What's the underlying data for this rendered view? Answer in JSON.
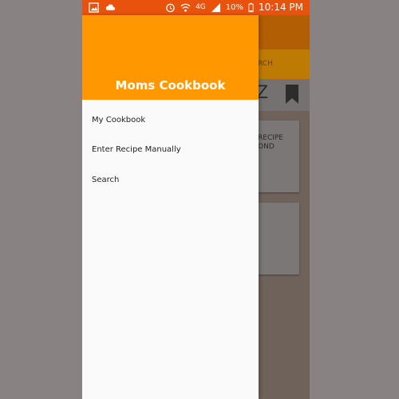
{
  "status_bar": {
    "network_label": "4G",
    "battery_percent": "10%",
    "time": "10:14 PM",
    "color": "#e8520c"
  },
  "drawer": {
    "title": "Moms Cookbook",
    "header_color": "#ff9800",
    "items": [
      {
        "label": "My Cookbook"
      },
      {
        "label": "Enter Recipe Manually"
      },
      {
        "label": "Search"
      }
    ]
  },
  "background_app": {
    "tab_label": "RCH",
    "sort_label": "Z",
    "card_text": "RECIPE\nOND"
  }
}
